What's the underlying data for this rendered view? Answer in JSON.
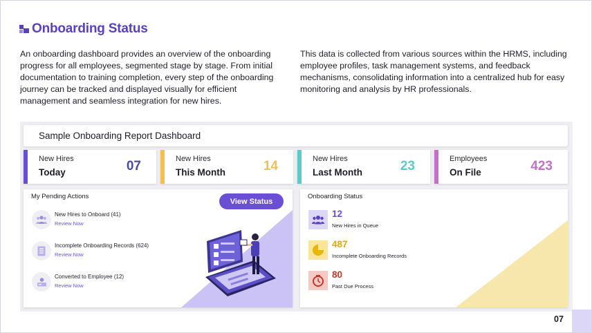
{
  "header": {
    "title": "Onboarding Status"
  },
  "intro": {
    "left": "An onboarding dashboard provides an overview of the onboarding progress for all employees, segmented stage by stage. From initial documentation to training completion, every step of the onboarding journey can be tracked and displayed visually for efficient management and seamless integration for new hires.",
    "right": "This data is collected from various sources within the HRMS, including employee profiles, task management systems, and feedback mechanisms, consolidating information into a centralized hub for easy monitoring and analysis by HR professionals."
  },
  "dashboard": {
    "title": "Sample Onboarding Report Dashboard",
    "kpis": [
      {
        "line1": "New Hires",
        "line2": "Today",
        "value": "07",
        "color": "#6a4fd6"
      },
      {
        "line1": "New Hires",
        "line2": "This Month",
        "value": "14",
        "color": "#f2c14e"
      },
      {
        "line1": "New Hires",
        "line2": "Last Month",
        "value": "23",
        "color": "#5cc9cc"
      },
      {
        "line1": "Employees",
        "line2": "On File",
        "value": "423",
        "color": "#c270c8"
      }
    ],
    "pending": {
      "title": "My Pending Actions",
      "button": "View Status",
      "items": [
        {
          "label": "New Hires to Onboard (41)",
          "link": "Review Now",
          "icon": "people-icon"
        },
        {
          "label": "Incomplete Onboarding Records (624)",
          "link": "Review Now",
          "icon": "document-icon"
        },
        {
          "label": "Converted to Employee (12)",
          "link": "Review Now",
          "icon": "id-card-icon"
        }
      ]
    },
    "status": {
      "title": "Onboarding Status",
      "items": [
        {
          "value": "12",
          "label": "New Hires in Queue",
          "color": "#6a4fd6",
          "icon": "group-icon"
        },
        {
          "value": "487",
          "label": "Incomplete Onboarding Records",
          "color": "#e0a800",
          "icon": "pie-icon"
        },
        {
          "value": "80",
          "label": "Past Due Process",
          "color": "#c0392b",
          "icon": "alarm-icon"
        }
      ]
    }
  },
  "page": {
    "number": "07"
  }
}
